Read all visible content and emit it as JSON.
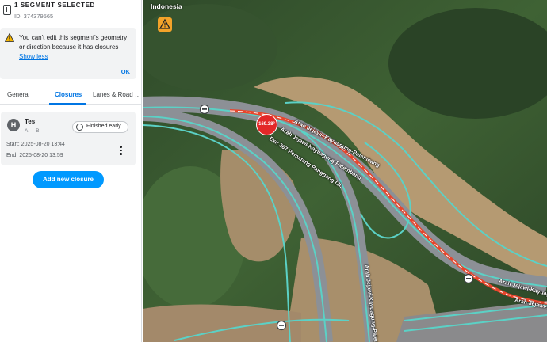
{
  "segment": {
    "title": "1 SEGMENT SELECTED",
    "id_label": "ID: 374379565"
  },
  "alert": {
    "message": "You can't edit this segment's geometry or direction because it has closures",
    "link": "Show less",
    "ok": "OK",
    "icon": "warning-icon"
  },
  "tabs": [
    {
      "label": "General"
    },
    {
      "label": "Closures"
    },
    {
      "label": "Lanes & Road …"
    }
  ],
  "closure": {
    "name": "Tes",
    "direction": "A → B",
    "status": "Finished early",
    "start": "Start: 2025-08-20 13:44",
    "end": "End: 2025-08-20 13:59"
  },
  "add_closure": "Add new closure",
  "map": {
    "country": "Indonesia",
    "marker": "169.38°",
    "road_labels": [
      "Arah Jejawi- Kayuagung-Palembang",
      "Arah Jejawi-Kayuagung-Palembang",
      "Exit 367 Pematang Panggang (Jl.",
      "Arah Jejawi-Kayuagung-Palembang",
      "Arah Jejawi-Kayuagung-Palemba",
      "Arah Jejawi-Kayuagung-Palem"
    ],
    "colors": {
      "closure": "#e8452c",
      "road": "#5bd1c6",
      "highway": "#a0a4aa"
    }
  }
}
